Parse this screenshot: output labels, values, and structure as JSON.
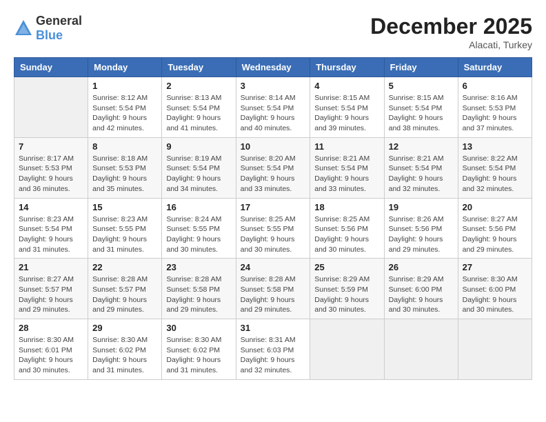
{
  "logo": {
    "general": "General",
    "blue": "Blue"
  },
  "title": {
    "month_year": "December 2025",
    "location": "Alacati, Turkey"
  },
  "weekdays": [
    "Sunday",
    "Monday",
    "Tuesday",
    "Wednesday",
    "Thursday",
    "Friday",
    "Saturday"
  ],
  "weeks": [
    [
      {
        "day": "",
        "sunrise": "",
        "sunset": "",
        "daylight": ""
      },
      {
        "day": "1",
        "sunrise": "Sunrise: 8:12 AM",
        "sunset": "Sunset: 5:54 PM",
        "daylight": "Daylight: 9 hours and 42 minutes."
      },
      {
        "day": "2",
        "sunrise": "Sunrise: 8:13 AM",
        "sunset": "Sunset: 5:54 PM",
        "daylight": "Daylight: 9 hours and 41 minutes."
      },
      {
        "day": "3",
        "sunrise": "Sunrise: 8:14 AM",
        "sunset": "Sunset: 5:54 PM",
        "daylight": "Daylight: 9 hours and 40 minutes."
      },
      {
        "day": "4",
        "sunrise": "Sunrise: 8:15 AM",
        "sunset": "Sunset: 5:54 PM",
        "daylight": "Daylight: 9 hours and 39 minutes."
      },
      {
        "day": "5",
        "sunrise": "Sunrise: 8:15 AM",
        "sunset": "Sunset: 5:54 PM",
        "daylight": "Daylight: 9 hours and 38 minutes."
      },
      {
        "day": "6",
        "sunrise": "Sunrise: 8:16 AM",
        "sunset": "Sunset: 5:53 PM",
        "daylight": "Daylight: 9 hours and 37 minutes."
      }
    ],
    [
      {
        "day": "7",
        "sunrise": "Sunrise: 8:17 AM",
        "sunset": "Sunset: 5:53 PM",
        "daylight": "Daylight: 9 hours and 36 minutes."
      },
      {
        "day": "8",
        "sunrise": "Sunrise: 8:18 AM",
        "sunset": "Sunset: 5:53 PM",
        "daylight": "Daylight: 9 hours and 35 minutes."
      },
      {
        "day": "9",
        "sunrise": "Sunrise: 8:19 AM",
        "sunset": "Sunset: 5:54 PM",
        "daylight": "Daylight: 9 hours and 34 minutes."
      },
      {
        "day": "10",
        "sunrise": "Sunrise: 8:20 AM",
        "sunset": "Sunset: 5:54 PM",
        "daylight": "Daylight: 9 hours and 33 minutes."
      },
      {
        "day": "11",
        "sunrise": "Sunrise: 8:21 AM",
        "sunset": "Sunset: 5:54 PM",
        "daylight": "Daylight: 9 hours and 33 minutes."
      },
      {
        "day": "12",
        "sunrise": "Sunrise: 8:21 AM",
        "sunset": "Sunset: 5:54 PM",
        "daylight": "Daylight: 9 hours and 32 minutes."
      },
      {
        "day": "13",
        "sunrise": "Sunrise: 8:22 AM",
        "sunset": "Sunset: 5:54 PM",
        "daylight": "Daylight: 9 hours and 32 minutes."
      }
    ],
    [
      {
        "day": "14",
        "sunrise": "Sunrise: 8:23 AM",
        "sunset": "Sunset: 5:54 PM",
        "daylight": "Daylight: 9 hours and 31 minutes."
      },
      {
        "day": "15",
        "sunrise": "Sunrise: 8:23 AM",
        "sunset": "Sunset: 5:55 PM",
        "daylight": "Daylight: 9 hours and 31 minutes."
      },
      {
        "day": "16",
        "sunrise": "Sunrise: 8:24 AM",
        "sunset": "Sunset: 5:55 PM",
        "daylight": "Daylight: 9 hours and 30 minutes."
      },
      {
        "day": "17",
        "sunrise": "Sunrise: 8:25 AM",
        "sunset": "Sunset: 5:55 PM",
        "daylight": "Daylight: 9 hours and 30 minutes."
      },
      {
        "day": "18",
        "sunrise": "Sunrise: 8:25 AM",
        "sunset": "Sunset: 5:56 PM",
        "daylight": "Daylight: 9 hours and 30 minutes."
      },
      {
        "day": "19",
        "sunrise": "Sunrise: 8:26 AM",
        "sunset": "Sunset: 5:56 PM",
        "daylight": "Daylight: 9 hours and 29 minutes."
      },
      {
        "day": "20",
        "sunrise": "Sunrise: 8:27 AM",
        "sunset": "Sunset: 5:56 PM",
        "daylight": "Daylight: 9 hours and 29 minutes."
      }
    ],
    [
      {
        "day": "21",
        "sunrise": "Sunrise: 8:27 AM",
        "sunset": "Sunset: 5:57 PM",
        "daylight": "Daylight: 9 hours and 29 minutes."
      },
      {
        "day": "22",
        "sunrise": "Sunrise: 8:28 AM",
        "sunset": "Sunset: 5:57 PM",
        "daylight": "Daylight: 9 hours and 29 minutes."
      },
      {
        "day": "23",
        "sunrise": "Sunrise: 8:28 AM",
        "sunset": "Sunset: 5:58 PM",
        "daylight": "Daylight: 9 hours and 29 minutes."
      },
      {
        "day": "24",
        "sunrise": "Sunrise: 8:28 AM",
        "sunset": "Sunset: 5:58 PM",
        "daylight": "Daylight: 9 hours and 29 minutes."
      },
      {
        "day": "25",
        "sunrise": "Sunrise: 8:29 AM",
        "sunset": "Sunset: 5:59 PM",
        "daylight": "Daylight: 9 hours and 30 minutes."
      },
      {
        "day": "26",
        "sunrise": "Sunrise: 8:29 AM",
        "sunset": "Sunset: 6:00 PM",
        "daylight": "Daylight: 9 hours and 30 minutes."
      },
      {
        "day": "27",
        "sunrise": "Sunrise: 8:30 AM",
        "sunset": "Sunset: 6:00 PM",
        "daylight": "Daylight: 9 hours and 30 minutes."
      }
    ],
    [
      {
        "day": "28",
        "sunrise": "Sunrise: 8:30 AM",
        "sunset": "Sunset: 6:01 PM",
        "daylight": "Daylight: 9 hours and 30 minutes."
      },
      {
        "day": "29",
        "sunrise": "Sunrise: 8:30 AM",
        "sunset": "Sunset: 6:02 PM",
        "daylight": "Daylight: 9 hours and 31 minutes."
      },
      {
        "day": "30",
        "sunrise": "Sunrise: 8:30 AM",
        "sunset": "Sunset: 6:02 PM",
        "daylight": "Daylight: 9 hours and 31 minutes."
      },
      {
        "day": "31",
        "sunrise": "Sunrise: 8:31 AM",
        "sunset": "Sunset: 6:03 PM",
        "daylight": "Daylight: 9 hours and 32 minutes."
      },
      {
        "day": "",
        "sunrise": "",
        "sunset": "",
        "daylight": ""
      },
      {
        "day": "",
        "sunrise": "",
        "sunset": "",
        "daylight": ""
      },
      {
        "day": "",
        "sunrise": "",
        "sunset": "",
        "daylight": ""
      }
    ]
  ]
}
